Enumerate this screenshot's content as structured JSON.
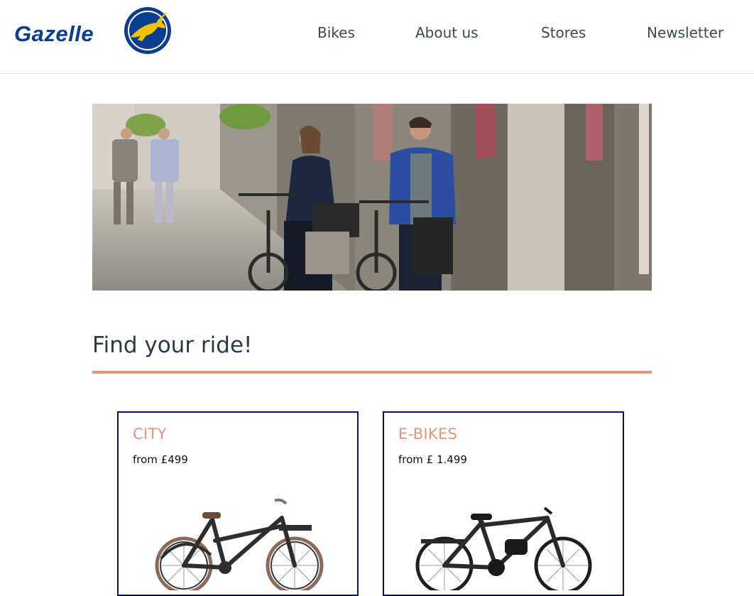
{
  "brand": {
    "name": "Gazelle",
    "primary_color": "#0b3d91",
    "accent_color": "#f2c200"
  },
  "nav": {
    "items": [
      {
        "label": "Bikes"
      },
      {
        "label": "About us"
      },
      {
        "label": "Stores"
      },
      {
        "label": "Newsletter"
      }
    ]
  },
  "hero": {
    "image": "street-couple-with-bikes"
  },
  "section": {
    "title": "Find your ride!",
    "rule_color": "#e3957b"
  },
  "cards": [
    {
      "category": "CITY",
      "price": "from £499",
      "image": "city-bike"
    },
    {
      "category": "E-BIKES",
      "price": "from £ 1.499",
      "image": "e-bike"
    }
  ]
}
